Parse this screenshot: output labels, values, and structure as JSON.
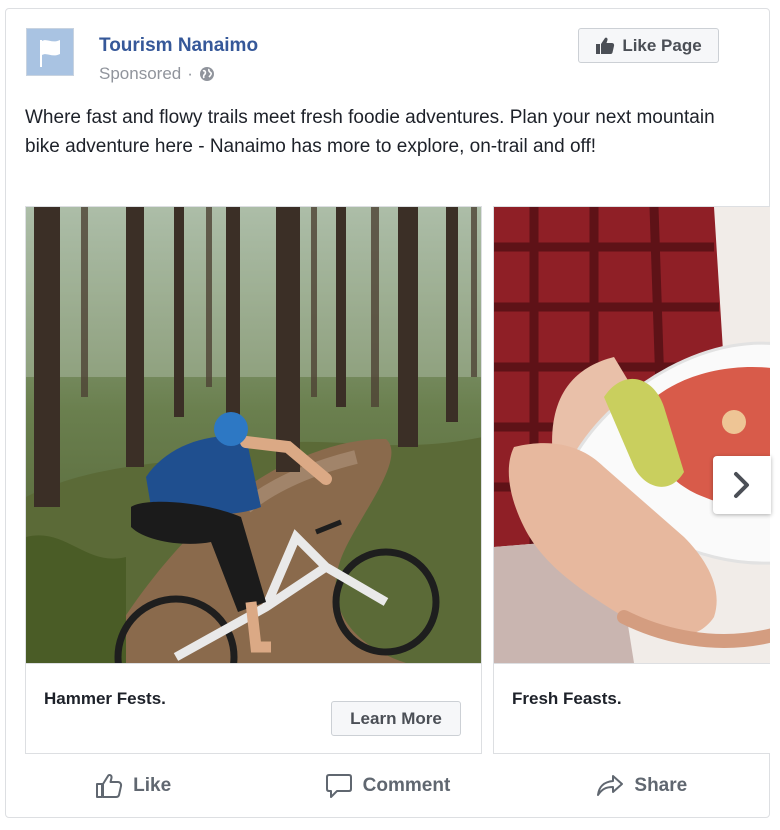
{
  "post": {
    "page_name": "Tourism Nanaimo",
    "sponsored_label": "Sponsored",
    "sponsored_separator": "·",
    "like_page_label": "Like Page",
    "text": "Where fast and flowy trails meet fresh foodie adventures. Plan your next mountain bike adventure here - Nanaimo has more to explore, on-trail and off!"
  },
  "carousel": {
    "cards": [
      {
        "headline": "Hammer Fests.",
        "cta_label": "Learn More",
        "image": "mountain-biker-in-forest"
      },
      {
        "headline": "Fresh Feasts.",
        "image": "hand-holding-food-bowl"
      }
    ],
    "next_icon": "chevron-right-icon"
  },
  "actions": {
    "like_label": "Like",
    "comment_label": "Comment",
    "share_label": "Share"
  },
  "colors": {
    "page_name": "#365899",
    "secondary_text": "#90949c",
    "action_text": "#606770",
    "border": "#dddfe2"
  }
}
